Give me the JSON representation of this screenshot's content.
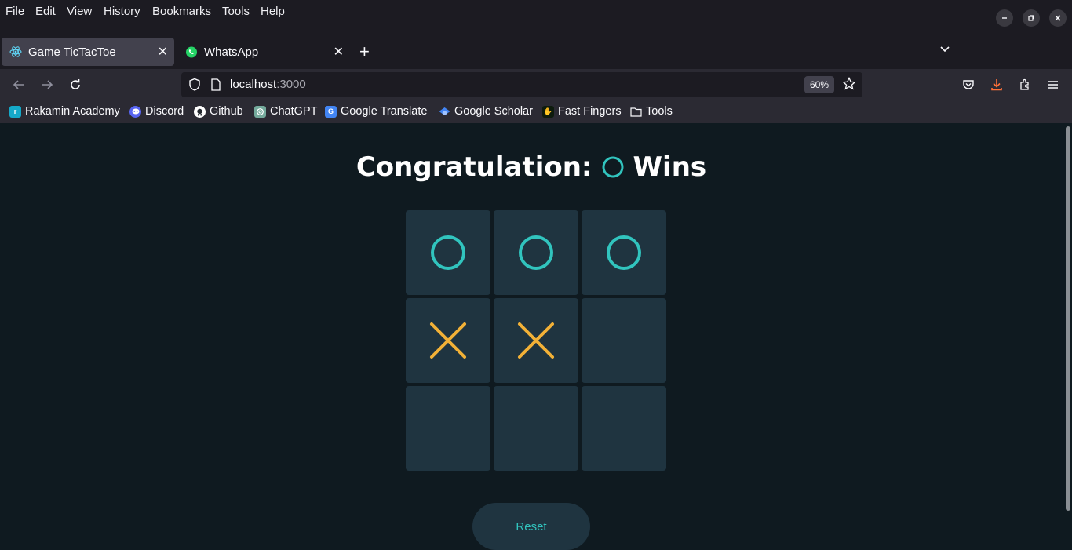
{
  "menu": [
    "File",
    "Edit",
    "View",
    "History",
    "Bookmarks",
    "Tools",
    "Help"
  ],
  "tabs": [
    {
      "title": "Game TicTacToe",
      "icon": "react-icon",
      "active": true
    },
    {
      "title": "WhatsApp",
      "icon": "whatsapp-icon",
      "active": false
    }
  ],
  "url": {
    "host": "localhost",
    "port": ":3000",
    "zoom": "60%"
  },
  "bookmarks": [
    {
      "label": "Rakamin Academy",
      "icon": "rakamin-icon",
      "color": "#15a9c9"
    },
    {
      "label": "Discord",
      "icon": "discord-icon",
      "color": "#5865f2"
    },
    {
      "label": "Github",
      "icon": "github-icon",
      "color": "#ffffff"
    },
    {
      "label": "ChatGPT",
      "icon": "chatgpt-icon",
      "color": "#74aa9c"
    },
    {
      "label": "Google Translate",
      "icon": "google-translate-icon",
      "color": "#4285f4"
    },
    {
      "label": "Google Scholar",
      "icon": "google-scholar-icon",
      "color": "#4285f4"
    },
    {
      "label": "Fast Fingers",
      "icon": "fast-fingers-icon",
      "color": "#d4a017"
    },
    {
      "label": "Tools",
      "icon": "folder-icon",
      "color": "#fbfbfe"
    }
  ],
  "game": {
    "title_prefix": "Congratulation:",
    "title_suffix": "Wins",
    "winner": "O",
    "board": [
      "O",
      "O",
      "O",
      "X",
      "X",
      "",
      "",
      "",
      ""
    ],
    "reset_label": "Reset",
    "colors": {
      "o": "#31c4be",
      "x": "#f2b137",
      "cell": "#1f3440",
      "background": "#0f1a20"
    }
  }
}
